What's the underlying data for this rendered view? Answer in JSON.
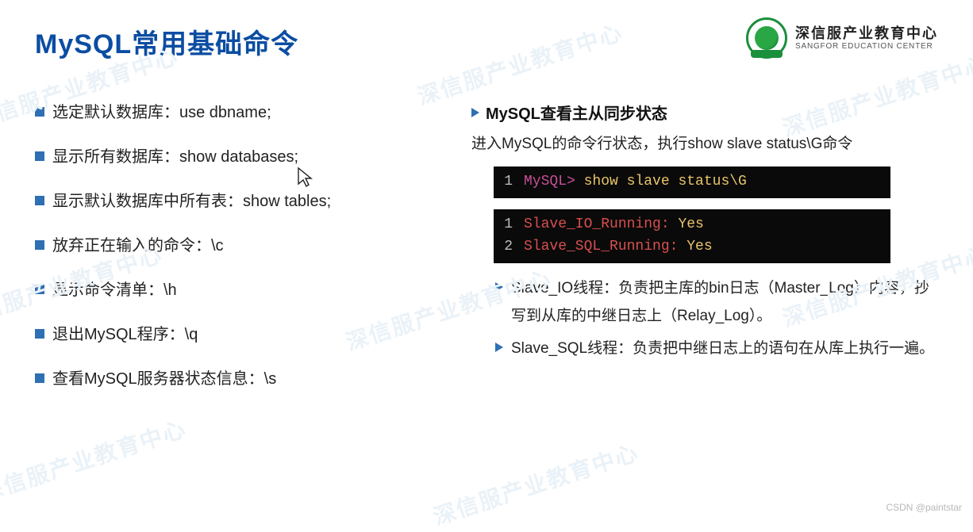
{
  "header": {
    "title": "MySQL常用基础命令",
    "logo": {
      "cn": "深信服产业教育中心",
      "en": "SANGFOR EDUCATION CENTER"
    }
  },
  "left": {
    "items": [
      "选定默认数据库：use dbname;",
      "显示所有数据库：show databases;",
      "显示默认数据库中所有表：show tables;",
      "放弃正在输入的命令：\\c",
      "显示命令清单：\\h",
      "退出MySQL程序：\\q",
      "查看MySQL服务器状态信息：\\s"
    ]
  },
  "right": {
    "section_title": "MySQL查看主从同步状态",
    "intro": "进入MySQL的命令行状态，执行show slave status\\G命令",
    "terminal1": {
      "line1_num": "1",
      "prompt": "MySQL>",
      "cmd": "show slave status\\G"
    },
    "terminal2": {
      "line1_num": "1",
      "line1_key": "Slave_IO_Running:",
      "line1_val": "Yes",
      "line2_num": "2",
      "line2_key": "Slave_SQL_Running:",
      "line2_val": "Yes"
    },
    "subs": [
      "Slave_IO线程：负责把主库的bin日志（Master_Log）内容，抄写到从库的中继日志上（Relay_Log）。",
      "Slave_SQL线程：负责把中继日志上的语句在从库上执行一遍。"
    ]
  },
  "watermark": "深信服产业教育中心",
  "footer": "CSDN @paintstar"
}
